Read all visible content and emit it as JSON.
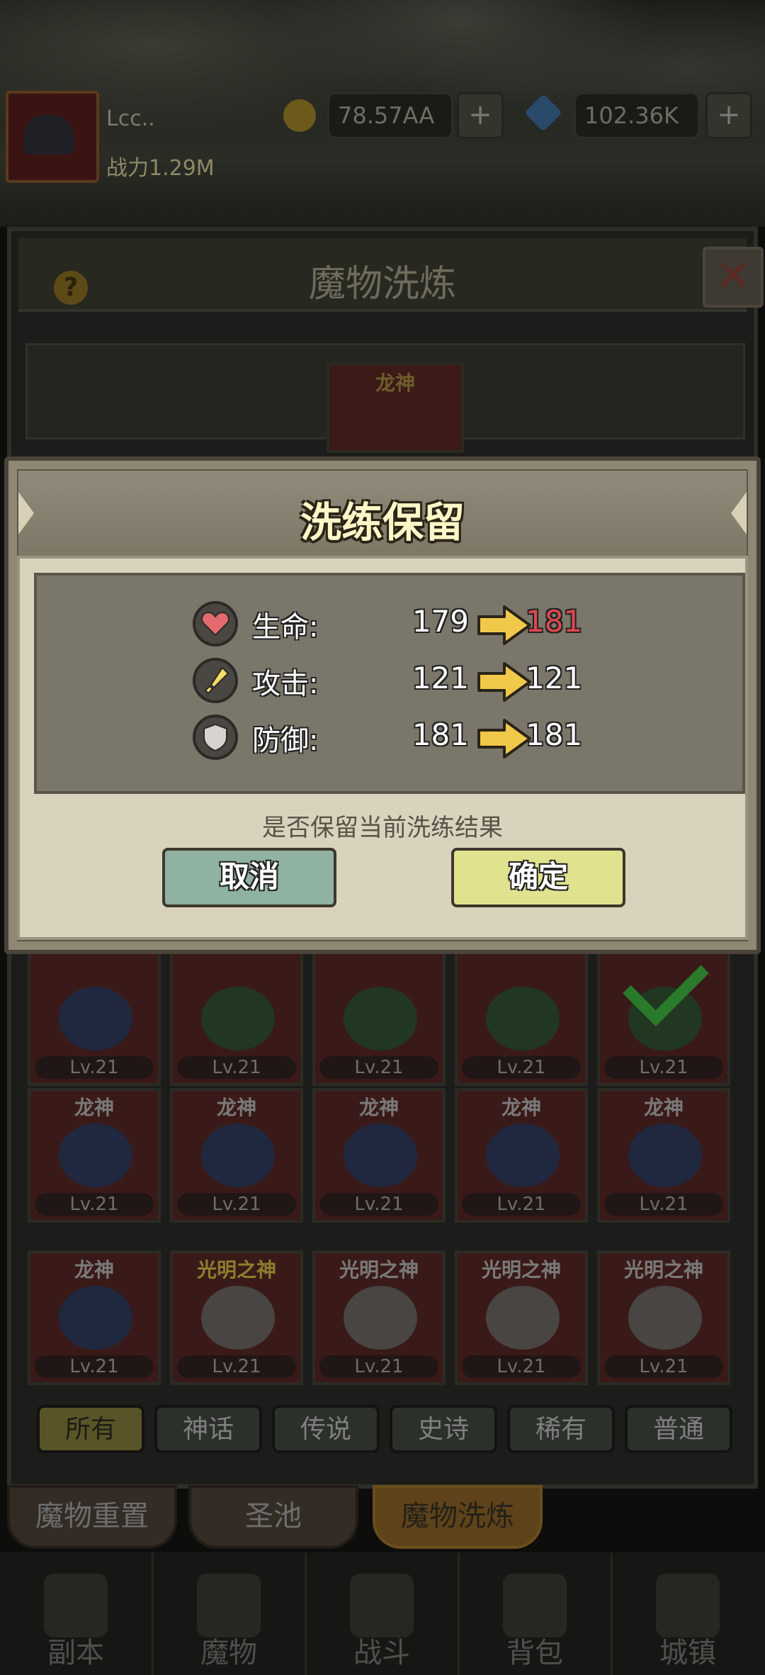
{
  "hud": {
    "player_name": "Lcc..",
    "power": "战力1.29M",
    "gold": "78.57AA",
    "gems": "102.36K"
  },
  "panel": {
    "title": "魔物洗炼",
    "preview_name": "龙神",
    "grid": [
      [
        {
          "name": "",
          "level": "Lv.21",
          "kind": "girl"
        },
        {
          "name": "",
          "level": "Lv.21",
          "kind": "green"
        },
        {
          "name": "",
          "level": "Lv.21",
          "kind": "green"
        },
        {
          "name": "",
          "level": "Lv.21",
          "kind": "green"
        },
        {
          "name": "",
          "level": "Lv.21",
          "kind": "green",
          "selected": true
        }
      ],
      [
        {
          "name": "龙神",
          "level": "Lv.21",
          "kind": "blue"
        },
        {
          "name": "龙神",
          "level": "Lv.21",
          "kind": "blue"
        },
        {
          "name": "龙神",
          "level": "Lv.21",
          "kind": "blue"
        },
        {
          "name": "龙神",
          "level": "Lv.21",
          "kind": "blue"
        },
        {
          "name": "龙神",
          "level": "Lv.21",
          "kind": "blue"
        }
      ],
      [
        {
          "name": "龙神",
          "level": "Lv.21",
          "kind": "blue"
        },
        {
          "name": "光明之神",
          "level": "Lv.21",
          "kind": "silver",
          "gold": true
        },
        {
          "name": "光明之神",
          "level": "Lv.21",
          "kind": "silver"
        },
        {
          "name": "光明之神",
          "level": "Lv.21",
          "kind": "silver"
        },
        {
          "name": "光明之神",
          "level": "Lv.21",
          "kind": "silver"
        }
      ]
    ],
    "filters": [
      "所有",
      "神话",
      "传说",
      "史诗",
      "稀有",
      "普通"
    ],
    "active_filter": 0
  },
  "subtabs": [
    "魔物重置",
    "圣池",
    "魔物洗炼"
  ],
  "bottom_nav": [
    "副本",
    "魔物",
    "战斗",
    "背包",
    "城镇"
  ],
  "dialog": {
    "title": "洗练保留",
    "stats": [
      {
        "icon": "heart-icon",
        "label": "生命:",
        "old": "179",
        "new": "181",
        "increased": true
      },
      {
        "icon": "sword-icon",
        "label": "攻击:",
        "old": "121",
        "new": "121",
        "increased": false
      },
      {
        "icon": "shield-icon",
        "label": "防御:",
        "old": "181",
        "new": "181",
        "increased": false
      }
    ],
    "question": "是否保留当前洗练结果",
    "cancel_label": "取消",
    "ok_label": "确定"
  },
  "colors": {
    "increase": "#e0474e",
    "cancel_button": "#8fb2a2",
    "ok_button": "#e1e28e"
  }
}
